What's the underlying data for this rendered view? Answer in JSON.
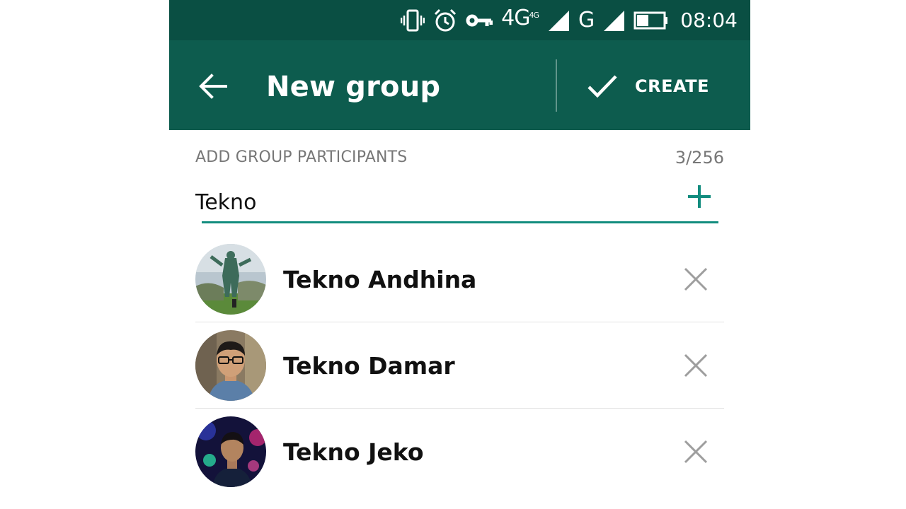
{
  "status_bar": {
    "network_main": "4G",
    "network_sup": "4G",
    "network_second": "G",
    "time": "08:04",
    "icons": [
      "vibrate-icon",
      "alarm-icon",
      "vpn-key-icon",
      "signal-icon",
      "signal-icon",
      "battery-icon"
    ]
  },
  "app_bar": {
    "title": "New group",
    "create_label": "CREATE",
    "back_icon": "arrow-left-icon",
    "create_icon": "check-icon",
    "color": "#0d5c4e"
  },
  "participants_section": {
    "header": "ADD GROUP PARTICIPANTS",
    "count": "3/256"
  },
  "search": {
    "value": "Tekno",
    "add_icon": "plus-icon",
    "accent": "#128c7e"
  },
  "participants": [
    {
      "name": "Tekno Andhina"
    },
    {
      "name": "Tekno Damar"
    },
    {
      "name": "Tekno Jeko"
    }
  ]
}
